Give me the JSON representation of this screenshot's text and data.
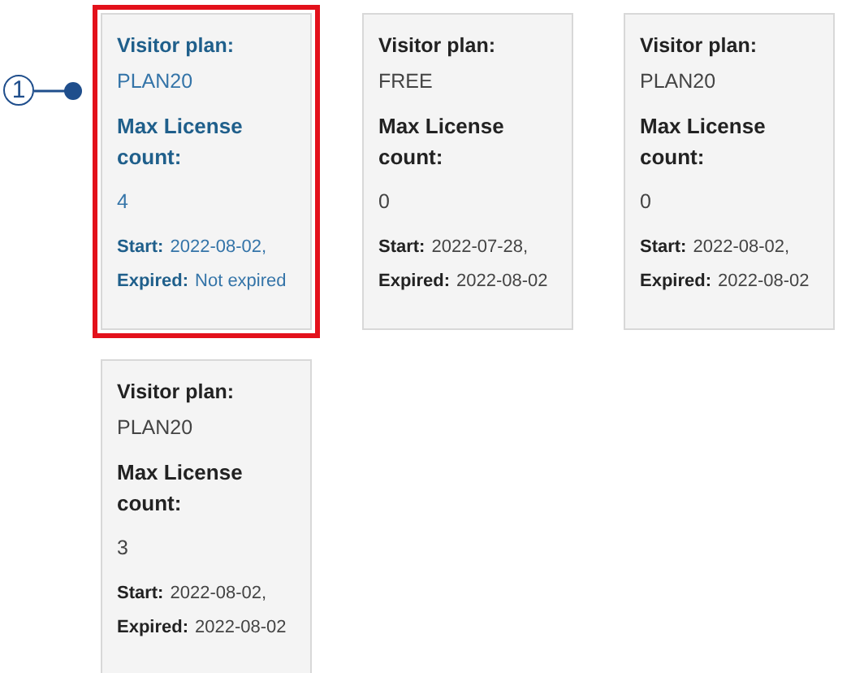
{
  "callout": {
    "label": "1"
  },
  "cards": [
    {
      "selected": true,
      "plan_label": "Visitor plan:",
      "plan": "PLAN20",
      "count_label": "Max License count:",
      "count": "4",
      "start_label": "Start:",
      "start": "2022-08-02,",
      "expired_label": "Expired:",
      "expired": "Not expired"
    },
    {
      "selected": false,
      "plan_label": "Visitor plan:",
      "plan": "FREE",
      "count_label": "Max License count:",
      "count": "0",
      "start_label": "Start:",
      "start": "2022-07-28,",
      "expired_label": "Expired:",
      "expired": "2022-08-02"
    },
    {
      "selected": false,
      "plan_label": "Visitor plan:",
      "plan": "PLAN20",
      "count_label": "Max License count:",
      "count": "0",
      "start_label": "Start:",
      "start": "2022-08-02,",
      "expired_label": "Expired:",
      "expired": "2022-08-02"
    },
    {
      "selected": false,
      "plan_label": "Visitor plan:",
      "plan": "PLAN20",
      "count_label": "Max License count:",
      "count": "3",
      "start_label": "Start:",
      "start": "2022-08-02,",
      "expired_label": "Expired:",
      "expired": "2022-08-02"
    }
  ]
}
